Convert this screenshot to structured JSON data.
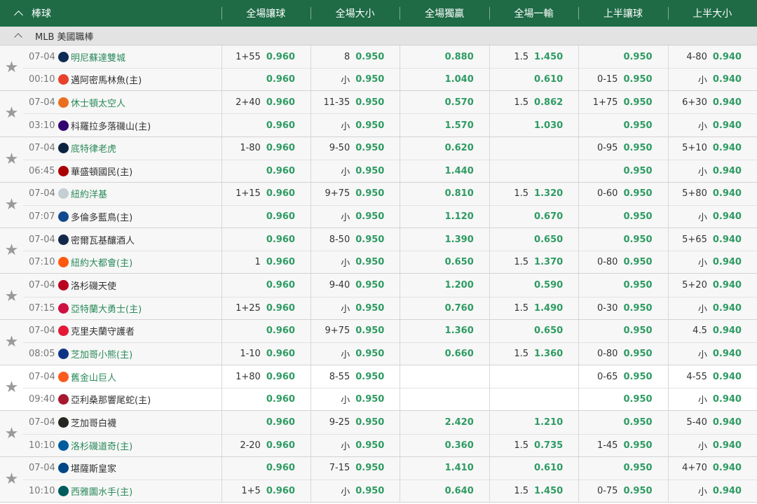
{
  "header": {
    "sport": "棒球",
    "columns": [
      "全場讓球",
      "全場大小",
      "全場獨贏",
      "全場一輸",
      "上半讓球",
      "上半大小"
    ]
  },
  "league": {
    "name": "MLB 美國職棒"
  },
  "matches": [
    {
      "home_row": {
        "date": "07-04",
        "team": "明尼蘇達雙城",
        "logo_color": "#0c2c56",
        "team_green": true,
        "cells": [
          [
            "1+55",
            "0.960"
          ],
          [
            "8",
            "0.950"
          ],
          [
            "",
            "0.880"
          ],
          [
            "1.5",
            "1.450"
          ],
          [
            "",
            "0.950"
          ],
          [
            "4-80",
            "0.940"
          ]
        ]
      },
      "away_row": {
        "time": "00:10",
        "team": "邁阿密馬林魚(主)",
        "logo_color": "#e8412b",
        "team_green": false,
        "cells": [
          [
            "",
            "0.960"
          ],
          [
            "小",
            "0.950"
          ],
          [
            "",
            "1.040"
          ],
          [
            "",
            "0.610"
          ],
          [
            "0-15",
            "0.950"
          ],
          [
            "小",
            "0.940"
          ]
        ]
      }
    },
    {
      "home_row": {
        "date": "07-04",
        "team": "休士頓太空人",
        "logo_color": "#eb6e1f",
        "team_green": true,
        "cells": [
          [
            "2+40",
            "0.960"
          ],
          [
            "11-35",
            "0.950"
          ],
          [
            "",
            "0.570"
          ],
          [
            "1.5",
            "0.862"
          ],
          [
            "1+75",
            "0.950"
          ],
          [
            "6+30",
            "0.940"
          ]
        ]
      },
      "away_row": {
        "time": "03:10",
        "team": "科羅拉多落磯山(主)",
        "logo_color": "#33006f",
        "team_green": false,
        "cells": [
          [
            "",
            "0.960"
          ],
          [
            "小",
            "0.950"
          ],
          [
            "",
            "1.570"
          ],
          [
            "",
            "1.030"
          ],
          [
            "",
            "0.950"
          ],
          [
            "小",
            "0.940"
          ]
        ]
      }
    },
    {
      "home_row": {
        "date": "07-04",
        "team": "底特律老虎",
        "logo_color": "#0c2340",
        "team_green": true,
        "cells": [
          [
            "1-80",
            "0.960"
          ],
          [
            "9-50",
            "0.950"
          ],
          [
            "",
            "0.620"
          ],
          [
            "",
            ""
          ],
          [
            "0-95",
            "0.950"
          ],
          [
            "5+10",
            "0.940"
          ]
        ]
      },
      "away_row": {
        "time": "06:45",
        "team": "華盛頓國民(主)",
        "logo_color": "#ab0003",
        "team_green": false,
        "cells": [
          [
            "",
            "0.960"
          ],
          [
            "小",
            "0.950"
          ],
          [
            "",
            "1.440"
          ],
          [
            "",
            ""
          ],
          [
            "",
            "0.950"
          ],
          [
            "小",
            "0.940"
          ]
        ]
      }
    },
    {
      "home_row": {
        "date": "07-04",
        "team": "紐約洋基",
        "logo_color": "#c4ced3",
        "team_green": true,
        "cells": [
          [
            "1+15",
            "0.960"
          ],
          [
            "9+75",
            "0.950"
          ],
          [
            "",
            "0.810"
          ],
          [
            "1.5",
            "1.320"
          ],
          [
            "0-60",
            "0.950"
          ],
          [
            "5+80",
            "0.940"
          ]
        ]
      },
      "away_row": {
        "time": "07:07",
        "team": "多倫多藍鳥(主)",
        "logo_color": "#134a8e",
        "team_green": false,
        "cells": [
          [
            "",
            "0.960"
          ],
          [
            "小",
            "0.950"
          ],
          [
            "",
            "1.120"
          ],
          [
            "",
            "0.670"
          ],
          [
            "",
            "0.950"
          ],
          [
            "小",
            "0.940"
          ]
        ]
      }
    },
    {
      "home_row": {
        "date": "07-04",
        "team": "密爾瓦基釀酒人",
        "logo_color": "#12284b",
        "team_green": false,
        "cells": [
          [
            "",
            "0.960"
          ],
          [
            "8-50",
            "0.950"
          ],
          [
            "",
            "1.390"
          ],
          [
            "",
            "0.650"
          ],
          [
            "",
            "0.950"
          ],
          [
            "5+65",
            "0.940"
          ]
        ]
      },
      "away_row": {
        "time": "07:10",
        "team": "紐約大都會(主)",
        "logo_color": "#ff5910",
        "team_green": true,
        "cells": [
          [
            "1",
            "0.960"
          ],
          [
            "小",
            "0.950"
          ],
          [
            "",
            "0.650"
          ],
          [
            "1.5",
            "1.370"
          ],
          [
            "0-80",
            "0.950"
          ],
          [
            "小",
            "0.940"
          ]
        ]
      }
    },
    {
      "home_row": {
        "date": "07-04",
        "team": "洛杉磯天使",
        "logo_color": "#ba0021",
        "team_green": false,
        "cells": [
          [
            "",
            "0.960"
          ],
          [
            "9-40",
            "0.950"
          ],
          [
            "",
            "1.200"
          ],
          [
            "",
            "0.590"
          ],
          [
            "",
            "0.950"
          ],
          [
            "5+20",
            "0.940"
          ]
        ]
      },
      "away_row": {
        "time": "07:15",
        "team": "亞特蘭大勇士(主)",
        "logo_color": "#ce1141",
        "team_green": true,
        "cells": [
          [
            "1+25",
            "0.960"
          ],
          [
            "小",
            "0.950"
          ],
          [
            "",
            "0.760"
          ],
          [
            "1.5",
            "1.490"
          ],
          [
            "0-30",
            "0.950"
          ],
          [
            "小",
            "0.940"
          ]
        ]
      }
    },
    {
      "home_row": {
        "date": "07-04",
        "team": "克里夫蘭守護者",
        "logo_color": "#e31937",
        "team_green": false,
        "cells": [
          [
            "",
            "0.960"
          ],
          [
            "9+75",
            "0.950"
          ],
          [
            "",
            "1.360"
          ],
          [
            "",
            "0.650"
          ],
          [
            "",
            "0.950"
          ],
          [
            "4.5",
            "0.940"
          ]
        ]
      },
      "away_row": {
        "time": "08:05",
        "team": "芝加哥小熊(主)",
        "logo_color": "#0e3386",
        "team_green": true,
        "cells": [
          [
            "1-10",
            "0.960"
          ],
          [
            "小",
            "0.950"
          ],
          [
            "",
            "0.660"
          ],
          [
            "1.5",
            "1.360"
          ],
          [
            "0-80",
            "0.950"
          ],
          [
            "小",
            "0.940"
          ]
        ]
      }
    },
    {
      "white": true,
      "home_row": {
        "date": "07-04",
        "team": "舊金山巨人",
        "logo_color": "#fd5a1e",
        "team_green": true,
        "cells": [
          [
            "1+80",
            "0.960"
          ],
          [
            "8-55",
            "0.950"
          ],
          [
            "",
            ""
          ],
          [
            "",
            ""
          ],
          [
            "0-65",
            "0.950"
          ],
          [
            "4-55",
            "0.940"
          ]
        ]
      },
      "away_row": {
        "time": "09:40",
        "team": "亞利桑那響尾蛇(主)",
        "logo_color": "#a71930",
        "team_green": false,
        "cells": [
          [
            "",
            "0.960"
          ],
          [
            "小",
            "0.950"
          ],
          [
            "",
            ""
          ],
          [
            "",
            ""
          ],
          [
            "",
            "0.950"
          ],
          [
            "小",
            "0.940"
          ]
        ]
      }
    },
    {
      "home_row": {
        "date": "07-04",
        "team": "芝加哥白襪",
        "logo_color": "#27251f",
        "team_green": false,
        "cells": [
          [
            "",
            "0.960"
          ],
          [
            "9-25",
            "0.950"
          ],
          [
            "",
            "2.420"
          ],
          [
            "",
            "1.210"
          ],
          [
            "",
            "0.950"
          ],
          [
            "5-40",
            "0.940"
          ]
        ]
      },
      "away_row": {
        "time": "10:10",
        "team": "洛杉磯道奇(主)",
        "logo_color": "#005a9c",
        "team_green": true,
        "cells": [
          [
            "2-20",
            "0.960"
          ],
          [
            "小",
            "0.950"
          ],
          [
            "",
            "0.360"
          ],
          [
            "1.5",
            "0.735"
          ],
          [
            "1-45",
            "0.950"
          ],
          [
            "小",
            "0.940"
          ]
        ]
      }
    },
    {
      "home_row": {
        "date": "07-04",
        "team": "堪薩斯皇家",
        "logo_color": "#004687",
        "team_green": false,
        "cells": [
          [
            "",
            "0.960"
          ],
          [
            "7-15",
            "0.950"
          ],
          [
            "",
            "1.410"
          ],
          [
            "",
            "0.610"
          ],
          [
            "",
            "0.950"
          ],
          [
            "4+70",
            "0.940"
          ]
        ]
      },
      "away_row": {
        "time": "10:10",
        "team": "西雅圖水手(主)",
        "logo_color": "#005c5c",
        "team_green": true,
        "cells": [
          [
            "1+5",
            "0.960"
          ],
          [
            "小",
            "0.950"
          ],
          [
            "",
            "0.640"
          ],
          [
            "1.5",
            "1.450"
          ],
          [
            "0-75",
            "0.950"
          ],
          [
            "小",
            "0.940"
          ]
        ]
      }
    }
  ]
}
